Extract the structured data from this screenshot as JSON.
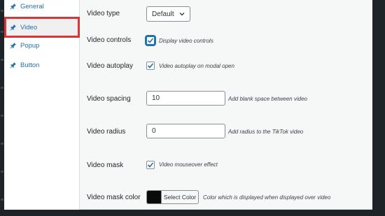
{
  "sidebar": {
    "items": [
      {
        "label": "General",
        "active": false,
        "icon": "pin-icon"
      },
      {
        "label": "Video",
        "active": true,
        "icon": "pin-icon"
      },
      {
        "label": "Popup",
        "active": false,
        "icon": "pin-icon"
      },
      {
        "label": "Button",
        "active": false,
        "icon": "pin-icon"
      }
    ]
  },
  "settings": {
    "video_type": {
      "label": "Video type",
      "value": "Default"
    },
    "video_controls": {
      "label": "Video controls",
      "checked": true,
      "hint": "Display video controls"
    },
    "video_autoplay": {
      "label": "Video autoplay",
      "checked": true,
      "hint": "Video autoplay on modal open"
    },
    "video_spacing": {
      "label": "Video spacing",
      "value": "10",
      "hint": "Add blank space between video"
    },
    "video_radius": {
      "label": "Video radius",
      "value": "0",
      "hint": "Add radius to the TikTok video"
    },
    "video_mask": {
      "label": "Video mask",
      "checked": true,
      "hint": "Video mouseover effect"
    },
    "video_mask_color": {
      "label": "Video mask color",
      "button": "Select Color",
      "color": "#0a0a0a",
      "hint": "Color which is displayed when displayed over video"
    }
  },
  "colors": {
    "accent": "#2271b1",
    "highlight": "#d63638",
    "dark": "#1d2327"
  }
}
